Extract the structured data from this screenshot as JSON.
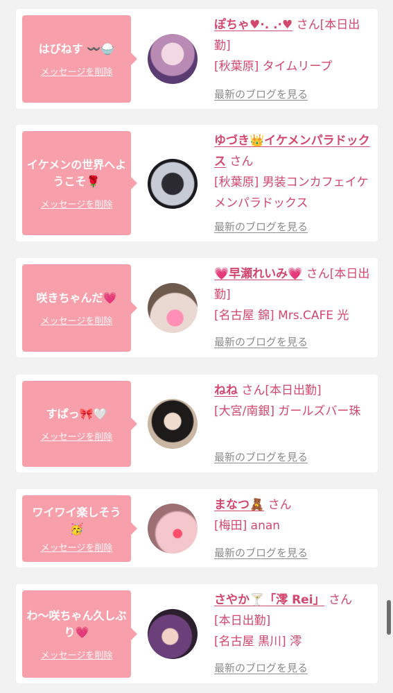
{
  "cards": [
    {
      "message": "はびねす 〰️🍚",
      "delete_label": "メッセージを削除",
      "name": "ぽちゃ♥·. .·♥",
      "honorific": "さん",
      "status": "[本日出勤]",
      "shop": "[秋葉原] タイムリープ",
      "blog_link": "最新のブログを見る"
    },
    {
      "message": "イケメンの世界へようこそ🌹",
      "delete_label": "メッセージを削除",
      "name": "ゆづき👑イケメンパラドックス",
      "honorific": "さん",
      "status": "",
      "shop": "[秋葉原] 男装コンカフェイケメンパラドックス",
      "blog_link": "最新のブログを見る"
    },
    {
      "message": "咲きちゃんだ💗",
      "delete_label": "メッセージを削除",
      "name": "💗早瀬れいみ💗",
      "honorific": "さん",
      "status": "[本日出勤]",
      "shop": "[名古屋 錦] Mrs.CAFE 光",
      "blog_link": "最新のブログを見る"
    },
    {
      "message": "すぱっ🎀🤍",
      "delete_label": "メッセージを削除",
      "name": "ねね",
      "honorific": "さん",
      "status": "[本日出勤]",
      "shop": "[大宮/南銀] ガールズバー珠",
      "blog_link": "最新のブログを見る"
    },
    {
      "message": "ワイワイ楽しそう🥳",
      "delete_label": "メッセージを削除",
      "name": "まなつ🧸",
      "honorific": "さん",
      "status": "",
      "shop": "[梅田] anan",
      "blog_link": "最新のブログを見る"
    },
    {
      "message": "わ〜咲ちゃん久しぶり💗",
      "delete_label": "メッセージを削除",
      "name": "さやか🍸「澪 Rei」",
      "honorific": "さん",
      "status": "[本日出勤]",
      "shop": "[名古屋 黒川] 澪",
      "blog_link": "最新のブログを見る"
    }
  ],
  "colors": {
    "accent": "#d2476e",
    "bubble": "#f7a0ac",
    "background": "#f2f2f2",
    "muted": "#8c8c8c"
  }
}
